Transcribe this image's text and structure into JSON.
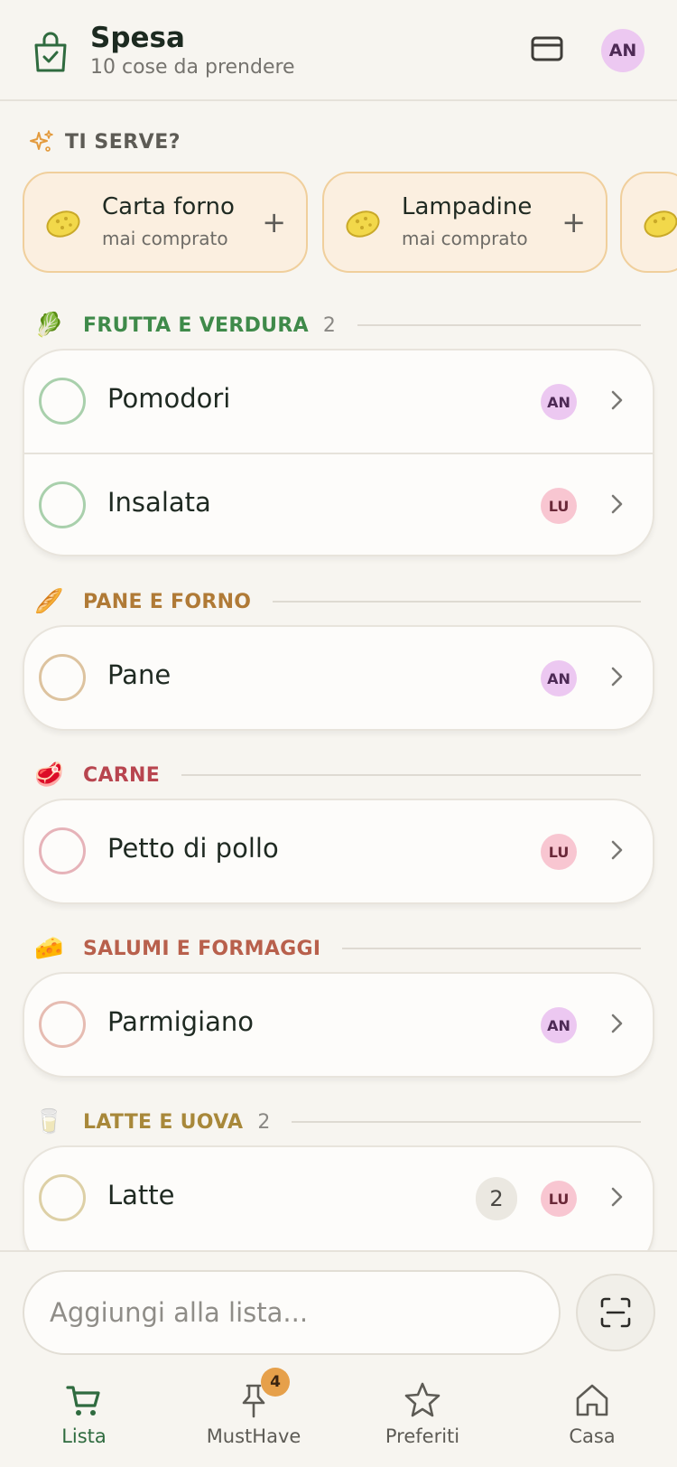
{
  "header": {
    "title": "Spesa",
    "subtitle": "10 cose da prendere",
    "user_initials": "AN"
  },
  "suggestions": {
    "title": "TI SERVE?",
    "items": [
      {
        "name": "Carta forno",
        "sub": "mai comprato"
      },
      {
        "name": "Lampadine",
        "sub": "mai comprato"
      }
    ]
  },
  "sections": [
    {
      "title": "FRUTTA E VERDURA",
      "count": "2",
      "icon": "leafy-greens-icon",
      "color": "#3f8a4a",
      "items": [
        {
          "name": "Pomodori",
          "user": "AN"
        },
        {
          "name": "Insalata",
          "user": "LU"
        }
      ]
    },
    {
      "title": "PANE E FORNO",
      "icon": "baguette-icon",
      "color": "#b07a36",
      "items": [
        {
          "name": "Pane",
          "user": "AN"
        }
      ]
    },
    {
      "title": "CARNE",
      "icon": "meat-icon",
      "color": "#b8454f",
      "items": [
        {
          "name": "Petto di pollo",
          "user": "LU"
        }
      ]
    },
    {
      "title": "SALUMI E FORMAGGI",
      "icon": "cheese-icon",
      "color": "#b8604c",
      "items": [
        {
          "name": "Parmigiano",
          "user": "AN"
        }
      ]
    },
    {
      "title": "LATTE E UOVA",
      "count": "2",
      "icon": "milk-glass-icon",
      "color": "#a8883a",
      "items": [
        {
          "name": "Latte",
          "qty": "2",
          "user": "LU"
        }
      ]
    }
  ],
  "add_input": {
    "placeholder": "Aggiungi alla lista..."
  },
  "nav": {
    "items": [
      {
        "label": "Lista",
        "icon": "cart-icon",
        "active": true
      },
      {
        "label": "MustHave",
        "icon": "pin-icon",
        "badge": "4"
      },
      {
        "label": "Preferiti",
        "icon": "star-icon"
      },
      {
        "label": "Casa",
        "icon": "home-icon"
      }
    ]
  },
  "colors": {
    "accent": "#2f6b3f",
    "background": "#f7f5f0",
    "suggestion_bg": "#fbefe0",
    "badge": "#e6a04a"
  }
}
